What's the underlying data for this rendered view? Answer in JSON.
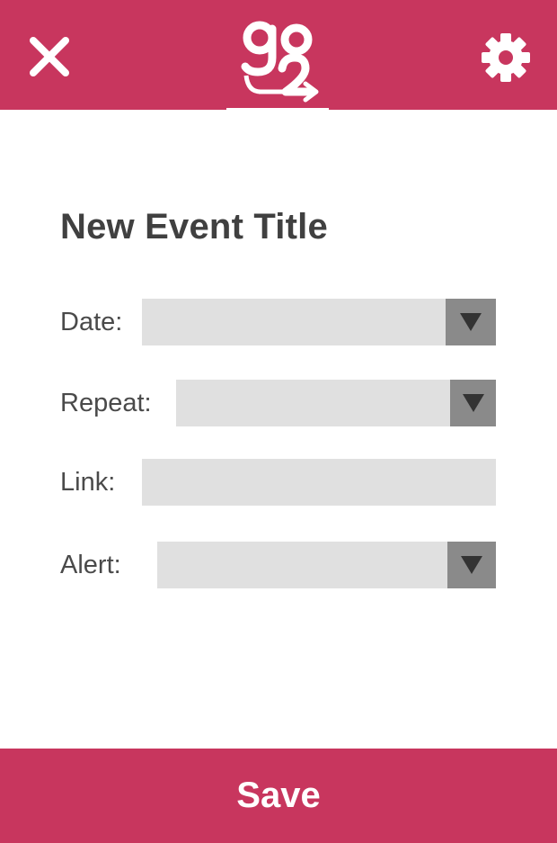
{
  "colors": {
    "brand": "#c8365e",
    "field_bg": "#e0e0e0",
    "dropdown_button": "#8a8a8a",
    "text_dark": "#404040",
    "white": "#ffffff"
  },
  "header": {
    "close_icon": "close-icon",
    "settings_icon": "gear-icon",
    "logo_text": "go2"
  },
  "form": {
    "title": "New Event Title",
    "fields": [
      {
        "label": "Date:",
        "type": "dropdown",
        "value": ""
      },
      {
        "label": "Repeat:",
        "type": "dropdown",
        "value": ""
      },
      {
        "label": "Link:",
        "type": "text",
        "value": "",
        "placeholder": ""
      },
      {
        "label": "Alert:",
        "type": "dropdown",
        "value": ""
      }
    ]
  },
  "footer": {
    "save_label": "Save"
  }
}
